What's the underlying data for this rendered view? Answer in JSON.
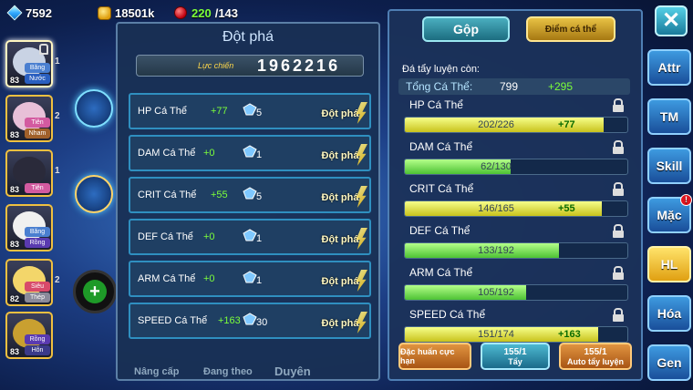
{
  "resources": {
    "diamonds": "7592",
    "gold": "18501k",
    "stamina_current": "220",
    "stamina_max": "/143"
  },
  "roster": [
    {
      "level": "83",
      "tag1": "Băng",
      "tag2": "Nước",
      "number": "1",
      "art_color": "#c9d3e4"
    },
    {
      "level": "83",
      "tag1": "Tiên",
      "tag2": "Nham",
      "number": "2",
      "art_color": "#e8c0d8"
    },
    {
      "level": "83",
      "tag1": "Tiên",
      "tag2": "",
      "number": "1",
      "art_color": "#2a2a3a"
    },
    {
      "level": "83",
      "tag1": "Băng",
      "tag2": "Rồng",
      "number": "",
      "art_color": "#f0f0f0"
    },
    {
      "level": "82",
      "tag1": "Siêu",
      "tag2": "Thép",
      "number": "2",
      "art_color": "#f3d66a"
    },
    {
      "level": "83",
      "tag1": "Rồng",
      "tag2": "Hôn",
      "number": "",
      "art_color": "#c9a030"
    }
  ],
  "breakthrough": {
    "title": "Đột phá",
    "power_label": "Lực chiến",
    "power_value": "1962216",
    "rows": [
      {
        "name": "HP Cá Thể",
        "plus": "+77",
        "count": "5",
        "button": "Đột phá"
      },
      {
        "name": "DAM Cá Thể",
        "plus": "+0",
        "count": "1",
        "button": "Đột phá"
      },
      {
        "name": "CRIT Cá Thể",
        "plus": "+55",
        "count": "5",
        "button": "Đột phá"
      },
      {
        "name": "DEF Cá Thể",
        "plus": "+0",
        "count": "1",
        "button": "Đột phá"
      },
      {
        "name": "ARM Cá Thể",
        "plus": "+0",
        "count": "1",
        "button": "Đột phá"
      },
      {
        "name": "SPEED Cá Thể",
        "plus": "+163",
        "count": "30",
        "button": "Đột phá"
      }
    ],
    "bottom_tabs": [
      "Nâng cấp",
      "Đang theo",
      "Duyên"
    ]
  },
  "training": {
    "tab_merge": "Gộp",
    "tab_points": "Điểm cá thể",
    "remaining_label": "Đá tẩy luyện còn:",
    "total_label": "Tổng Cá Thể:",
    "total_value": "799",
    "total_bonus": "+295",
    "stats": [
      {
        "name": "HP Cá Thể",
        "value": "202/226",
        "bonus": "+77",
        "fraction": 0.894,
        "highlight": true
      },
      {
        "name": "DAM Cá Thể",
        "value": "62/130",
        "bonus": "",
        "fraction": 0.477,
        "highlight": false
      },
      {
        "name": "CRIT Cá Thể",
        "value": "146/165",
        "bonus": "+55",
        "fraction": 0.885,
        "highlight": true
      },
      {
        "name": "DEF Cá Thể",
        "value": "133/192",
        "bonus": "",
        "fraction": 0.693,
        "highlight": false
      },
      {
        "name": "ARM Cá Thể",
        "value": "105/192",
        "bonus": "",
        "fraction": 0.547,
        "highlight": false
      },
      {
        "name": "SPEED Cá Thể",
        "value": "151/174",
        "bonus": "+163",
        "fraction": 0.868,
        "highlight": true
      }
    ],
    "btn_special": "Đặc huấn cực hạn",
    "btn_wash_count": "155/1",
    "btn_wash": "Tẩy",
    "btn_auto_count": "155/1",
    "btn_auto": "Auto tẩy luyện"
  },
  "sidebar": {
    "close": "✕",
    "items": [
      {
        "label": "Attr",
        "active": false,
        "badge": ""
      },
      {
        "label": "TM",
        "active": false,
        "badge": ""
      },
      {
        "label": "Skill",
        "active": false,
        "badge": ""
      },
      {
        "label": "Mặc",
        "active": false,
        "badge": "!"
      },
      {
        "label": "HL",
        "active": true,
        "badge": ""
      },
      {
        "label": "Hóa",
        "active": false,
        "badge": ""
      },
      {
        "label": "Gen",
        "active": false,
        "badge": ""
      }
    ]
  }
}
